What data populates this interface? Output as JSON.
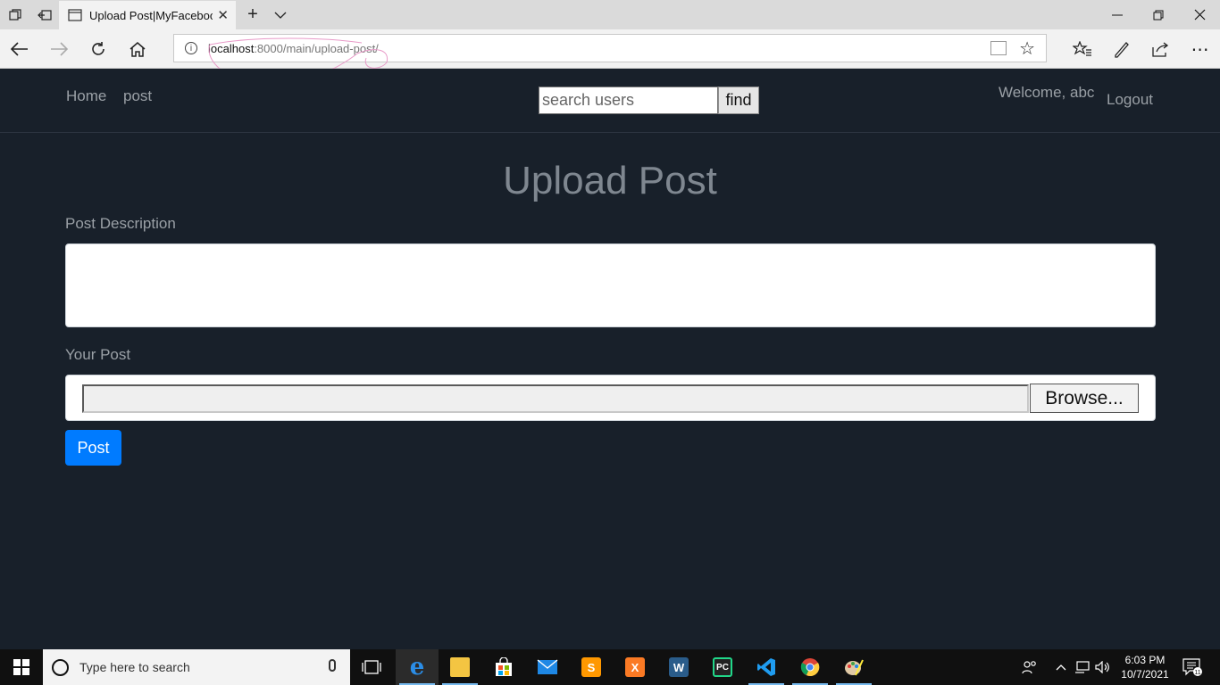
{
  "browser": {
    "tab_title": "Upload Post|MyFaceboo",
    "url_host": "localhost",
    "url_rest": ":8000/main/upload-post/"
  },
  "nav": {
    "home": "Home",
    "post": "post",
    "search_placeholder": "search users",
    "find": "find",
    "welcome": "Welcome, abc",
    "logout": "Logout"
  },
  "page": {
    "title": "Upload Post",
    "desc_label": "Post Description",
    "post_label": "Your Post",
    "browse": "Browse...",
    "submit": "Post"
  },
  "taskbar": {
    "search_text": "Type here to search",
    "time": "6:03 PM",
    "date": "10/7/2021",
    "notif_count": "11"
  },
  "colors": {
    "page_bg": "#18202a",
    "primary": "#007bff",
    "muted_text": "#9aa0a6"
  }
}
